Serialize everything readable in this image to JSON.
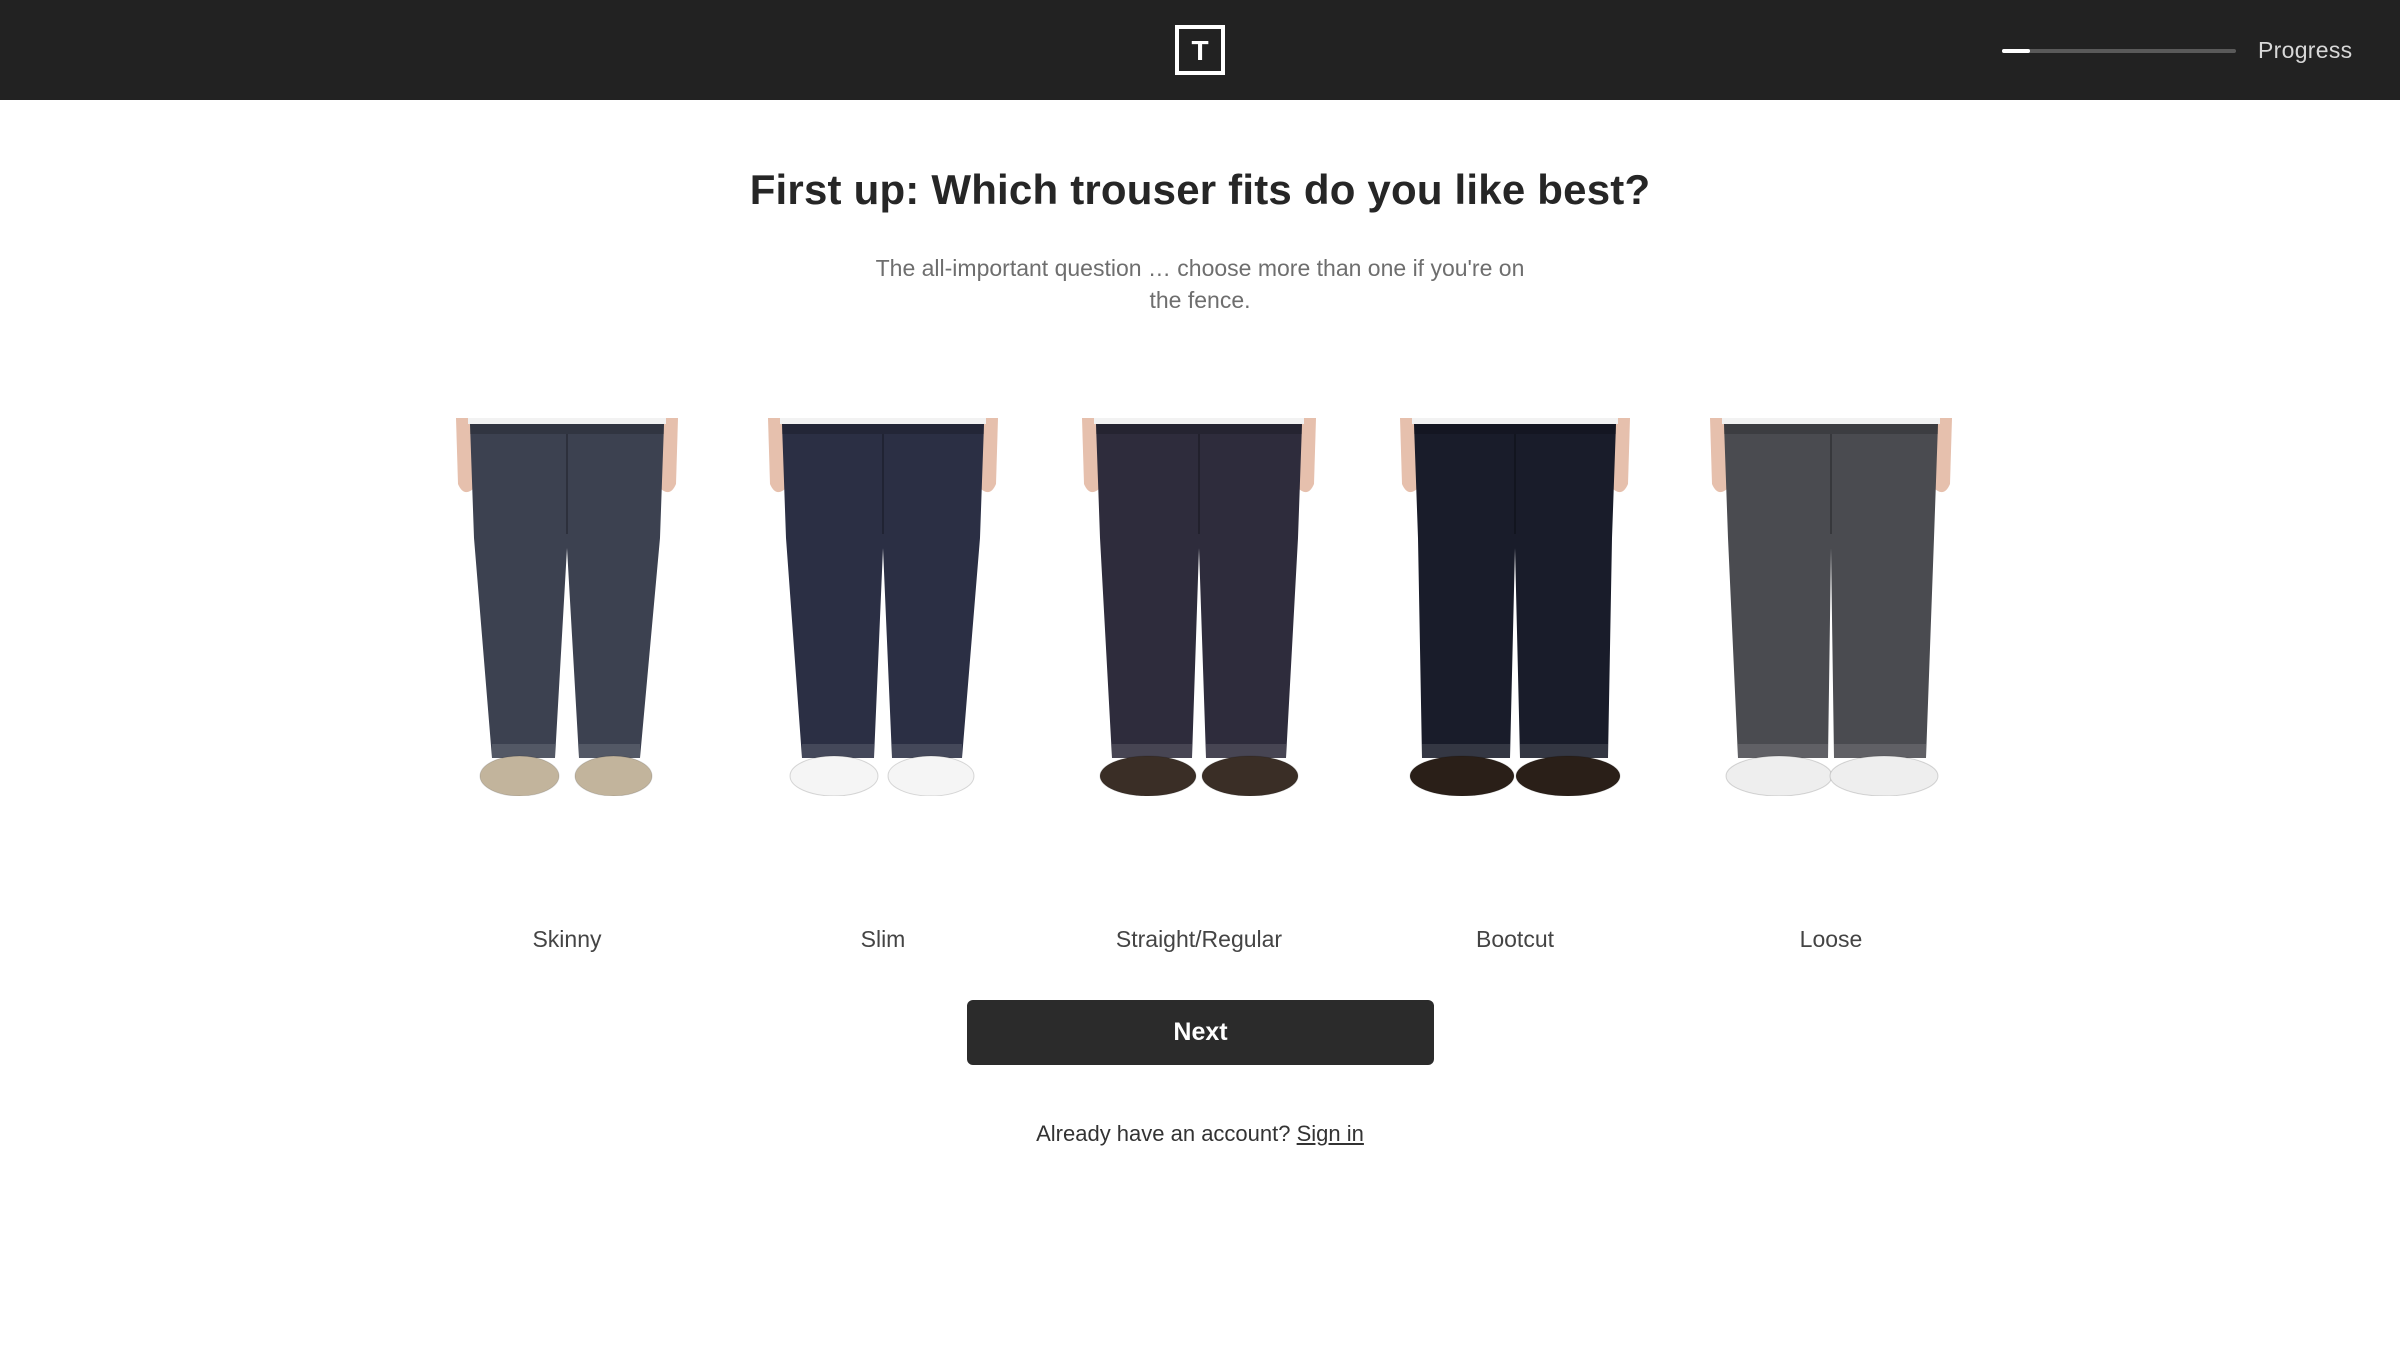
{
  "header": {
    "logo_letter": "T",
    "progress_label": "Progress",
    "progress_value": 0.12
  },
  "main": {
    "title": "First up: Which trouser fits do you like best?",
    "subtitle": "The all-important question … choose more than one if you're on the fence.",
    "fits": [
      {
        "label": "Skinny",
        "denim": "#3c4150",
        "shoe": "#c2b49c"
      },
      {
        "label": "Slim",
        "denim": "#2b2f44",
        "shoe": "#f5f5f5"
      },
      {
        "label": "Straight/Regular",
        "denim": "#2e2c3c",
        "shoe": "#3a2e26"
      },
      {
        "label": "Bootcut",
        "denim": "#191c2a",
        "shoe": "#2a1f18"
      },
      {
        "label": "Loose",
        "denim": "#4a4b50",
        "shoe": "#eeeeee"
      }
    ],
    "next_label": "Next",
    "signin_prompt": "Already have an account?",
    "signin_link": "Sign in"
  },
  "colors": {
    "header_bg": "#222222",
    "button_bg": "#2b2b2b",
    "skin": "#e6c0ad"
  }
}
